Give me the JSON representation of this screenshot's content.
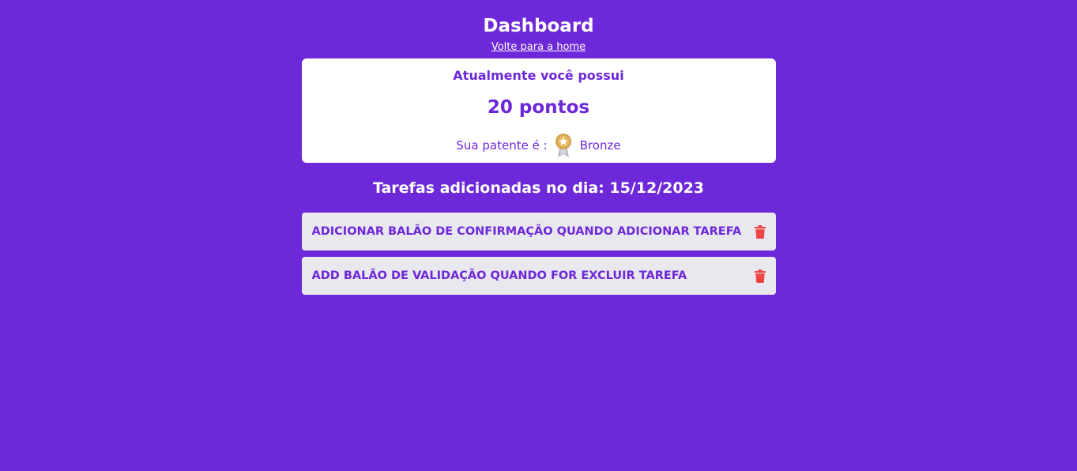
{
  "header": {
    "title": "Dashboard",
    "home_link": "Volte para a home"
  },
  "points_card": {
    "heading": "Atualmente você possui",
    "points": "20 pontos",
    "rank_label": "Sua patente é :",
    "rank_icon": "medal-icon",
    "rank_value": "Bronze"
  },
  "tasks": {
    "heading": "Tarefas adicionadas no dia: 15/12/2023",
    "items": [
      {
        "text": "ADICIONAR BALÃO DE CONFIRMAÇÃO QUANDO ADICIONAR TAREFA",
        "icon": "trash-icon"
      },
      {
        "text": "ADD BALÃO DE VALIDAÇÃO QUANDO FOR EXCLUIR TAREFA",
        "icon": "trash-icon"
      }
    ]
  },
  "colors": {
    "background": "#6d28d9",
    "card": "#ffffff",
    "task_bg": "#e8e8ee",
    "delete": "#ef4444",
    "medal": "#d4a24c"
  }
}
